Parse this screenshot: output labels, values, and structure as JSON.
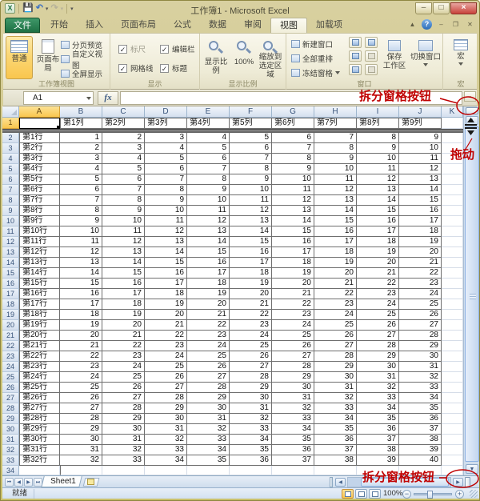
{
  "window": {
    "title": "工作簿1 - Microsoft Excel",
    "controls": {
      "minimize": "–",
      "maximize": "□",
      "close": "×"
    },
    "qat_icons": [
      "excel-logo",
      "save-icon",
      "undo-icon",
      "redo-icon",
      "customize-qat-icon"
    ]
  },
  "ribbon": {
    "file_tab": "文件",
    "tabs": [
      "开始",
      "插入",
      "页面布局",
      "公式",
      "数据",
      "审阅",
      "视图",
      "加载项"
    ],
    "active_tab": "视图",
    "groups": [
      {
        "label": "工作簿视图",
        "buttons": [
          {
            "label": "普通",
            "active": true
          },
          {
            "label": "页面布局"
          },
          {
            "label": "分页预览"
          },
          {
            "label": "自定义视图"
          },
          {
            "label": "全屏显示"
          }
        ]
      },
      {
        "label": "显示",
        "checkboxes": [
          {
            "label": "标尺",
            "checked": true,
            "disabled": true
          },
          {
            "label": "编辑栏",
            "checked": true
          },
          {
            "label": "网格线",
            "checked": true
          },
          {
            "label": "标题",
            "checked": true
          }
        ]
      },
      {
        "label": "显示比例",
        "buttons": [
          {
            "lines": [
              "显示比例"
            ]
          },
          {
            "lines": [
              "100%"
            ]
          },
          {
            "lines": [
              "缩放到",
              "选定区域"
            ]
          }
        ]
      },
      {
        "label": "窗口",
        "buttons": [
          {
            "label": "新建窗口"
          },
          {
            "label": "全部重排"
          },
          {
            "label": "冻结窗格",
            "dropdown": true
          },
          {
            "lines": [
              "保存",
              "工作区"
            ]
          },
          {
            "lines": [
              "切换窗口"
            ],
            "dropdown": true
          }
        ],
        "icon_buttons": [
          "split-icon",
          "hide-window-icon",
          "unhide-window-icon",
          "view-side-by-side-icon",
          "synchronous-scrolling-icon",
          "reset-window-position-icon"
        ]
      },
      {
        "label": "宏",
        "buttons": [
          {
            "lines": [
              "宏"
            ],
            "dropdown": true
          }
        ]
      }
    ]
  },
  "formula_bar": {
    "name_box": "A1",
    "fx": "fx",
    "formula": ""
  },
  "grid": {
    "selected_cell": "A1",
    "column_headers": [
      "A",
      "B",
      "C",
      "D",
      "E",
      "F",
      "G",
      "H",
      "I",
      "J",
      "K"
    ],
    "header_row": {
      "number": 1,
      "a": "",
      "cells": [
        "第1列",
        "第2列",
        "第3列",
        "第4列",
        "第5列",
        "第6列",
        "第7列",
        "第8列",
        "第9列"
      ]
    },
    "rows": [
      {
        "number": 2,
        "label": "第1行",
        "values": [
          1,
          2,
          3,
          4,
          5,
          6,
          7,
          8,
          9
        ]
      },
      {
        "number": 3,
        "label": "第2行",
        "values": [
          2,
          3,
          4,
          5,
          6,
          7,
          8,
          9,
          10
        ]
      },
      {
        "number": 4,
        "label": "第3行",
        "values": [
          3,
          4,
          5,
          6,
          7,
          8,
          9,
          10,
          11
        ]
      },
      {
        "number": 5,
        "label": "第4行",
        "values": [
          4,
          5,
          6,
          7,
          8,
          9,
          10,
          11,
          12
        ]
      },
      {
        "number": 6,
        "label": "第5行",
        "values": [
          5,
          6,
          7,
          8,
          9,
          10,
          11,
          12,
          13
        ]
      },
      {
        "number": 7,
        "label": "第6行",
        "values": [
          6,
          7,
          8,
          9,
          10,
          11,
          12,
          13,
          14
        ]
      },
      {
        "number": 8,
        "label": "第7行",
        "values": [
          7,
          8,
          9,
          10,
          11,
          12,
          13,
          14,
          15
        ]
      },
      {
        "number": 9,
        "label": "第8行",
        "values": [
          8,
          9,
          10,
          11,
          12,
          13,
          14,
          15,
          16
        ]
      },
      {
        "number": 10,
        "label": "第9行",
        "values": [
          9,
          10,
          11,
          12,
          13,
          14,
          15,
          16,
          17
        ]
      },
      {
        "number": 11,
        "label": "第10行",
        "values": [
          10,
          11,
          12,
          13,
          14,
          15,
          16,
          17,
          18
        ]
      },
      {
        "number": 12,
        "label": "第11行",
        "values": [
          11,
          12,
          13,
          14,
          15,
          16,
          17,
          18,
          19
        ]
      },
      {
        "number": 13,
        "label": "第12行",
        "values": [
          12,
          13,
          14,
          15,
          16,
          17,
          18,
          19,
          20
        ]
      },
      {
        "number": 14,
        "label": "第13行",
        "values": [
          13,
          14,
          15,
          16,
          17,
          18,
          19,
          20,
          21
        ]
      },
      {
        "number": 15,
        "label": "第14行",
        "values": [
          14,
          15,
          16,
          17,
          18,
          19,
          20,
          21,
          22
        ]
      },
      {
        "number": 16,
        "label": "第15行",
        "values": [
          15,
          16,
          17,
          18,
          19,
          20,
          21,
          22,
          23
        ]
      },
      {
        "number": 17,
        "label": "第16行",
        "values": [
          16,
          17,
          18,
          19,
          20,
          21,
          22,
          23,
          24
        ]
      },
      {
        "number": 18,
        "label": "第17行",
        "values": [
          17,
          18,
          19,
          20,
          21,
          22,
          23,
          24,
          25
        ]
      },
      {
        "number": 19,
        "label": "第18行",
        "values": [
          18,
          19,
          20,
          21,
          22,
          23,
          24,
          25,
          26
        ]
      },
      {
        "number": 20,
        "label": "第19行",
        "values": [
          19,
          20,
          21,
          22,
          23,
          24,
          25,
          26,
          27
        ]
      },
      {
        "number": 21,
        "label": "第20行",
        "values": [
          20,
          21,
          22,
          23,
          24,
          25,
          26,
          27,
          28
        ]
      },
      {
        "number": 22,
        "label": "第21行",
        "values": [
          21,
          22,
          23,
          24,
          25,
          26,
          27,
          28,
          29
        ]
      },
      {
        "number": 23,
        "label": "第22行",
        "values": [
          22,
          23,
          24,
          25,
          26,
          27,
          28,
          29,
          30
        ]
      },
      {
        "number": 24,
        "label": "第23行",
        "values": [
          23,
          24,
          25,
          26,
          27,
          28,
          29,
          30,
          31
        ]
      },
      {
        "number": 25,
        "label": "第24行",
        "values": [
          24,
          25,
          26,
          27,
          28,
          29,
          30,
          31,
          32
        ]
      },
      {
        "number": 26,
        "label": "第25行",
        "values": [
          25,
          26,
          27,
          28,
          29,
          30,
          31,
          32,
          33
        ]
      },
      {
        "number": 27,
        "label": "第26行",
        "values": [
          26,
          27,
          28,
          29,
          30,
          31,
          32,
          33,
          34
        ]
      },
      {
        "number": 28,
        "label": "第27行",
        "values": [
          27,
          28,
          29,
          30,
          31,
          32,
          33,
          34,
          35
        ]
      },
      {
        "number": 29,
        "label": "第28行",
        "values": [
          28,
          29,
          30,
          31,
          32,
          33,
          34,
          35,
          36
        ]
      },
      {
        "number": 30,
        "label": "第29行",
        "values": [
          29,
          30,
          31,
          32,
          33,
          34,
          35,
          36,
          37
        ]
      },
      {
        "number": 31,
        "label": "第30行",
        "values": [
          30,
          31,
          32,
          33,
          34,
          35,
          36,
          37,
          38
        ]
      },
      {
        "number": 32,
        "label": "第31行",
        "values": [
          31,
          32,
          33,
          34,
          35,
          36,
          37,
          38,
          39
        ]
      },
      {
        "number": 33,
        "label": "第32行",
        "values": [
          32,
          33,
          34,
          35,
          36,
          37,
          38,
          39,
          40
        ]
      }
    ],
    "trailing_row_number": 34
  },
  "sheet_tabs": {
    "tabs": [
      {
        "label": "Sheet1",
        "active": true
      }
    ]
  },
  "status_bar": {
    "ready": "就绪",
    "zoom": "100%"
  },
  "annotations": {
    "top_split": "拆分窗格按钮",
    "drag": "拖动",
    "bottom_split": "拆分窗格按钮",
    "color": "#c00000"
  },
  "colors": {
    "annotation_red": "#c00000",
    "file_tab_green": "#1e7145",
    "selected_header_amber": "#f9c64e",
    "scrollbar_blue": "#cfdded",
    "split_bar_gray": "#6f6f6f",
    "window_chrome_gold": "#c9c06a"
  }
}
